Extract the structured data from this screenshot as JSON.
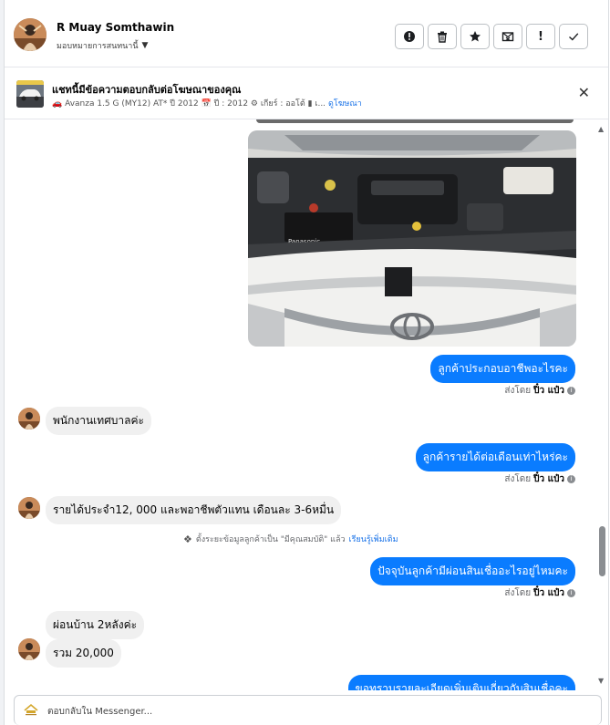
{
  "header": {
    "name": "R Muay Somthawin",
    "assign_label": "มอบหมายการสนทนานี้",
    "actions": [
      {
        "icon": "alert-circle-icon",
        "glyph": "❗"
      },
      {
        "icon": "trash-icon",
        "glyph": "🗑"
      },
      {
        "icon": "star-icon",
        "glyph": "★"
      },
      {
        "icon": "mail-x-icon",
        "glyph": "✉"
      },
      {
        "icon": "exclamation-icon",
        "glyph": "!"
      },
      {
        "icon": "check-icon",
        "glyph": "✓"
      }
    ]
  },
  "ad": {
    "title": "แชทนี้มีข้อความตอบกลับต่อโฆษณาของคุณ",
    "meta": "🚗 Avanza 1.5 G (MY12) AT* ปี 2012 📅 ปี : 2012 ⚙ เกียร์ : ออโต้ ▮ เ...",
    "link": "ดูโฆษณา"
  },
  "messages": {
    "out1": "ลูกค้าประกอบอาชีพอะไรคะ",
    "sent_prefix": "ส่งโดย",
    "sender": "ปิ๋ว แป๋ว",
    "in1": "พนักงานเทศบาลค่ะ",
    "out2": "ลูกค้ารายได้ต่อเดือนเท่าไหร่คะ",
    "in2": "รายได้ประจำ12, 000 และพอาชีพตัวแทน เดือนละ 3-6หมื่น",
    "system_text": "ตั้งระยะข้อมูลลูกค้าเป็น \"มีคุณสมบัติ\" แล้ว",
    "system_link": "เรียนรู้เพิ่มเติม",
    "out3": "ปัจจุบันลูกค้ามีผ่อนสินเชื่ออะไรอยู่ไหมคะ",
    "in3": "ผ่อนบ้าน 2หลังค่ะ",
    "in4": "รวม 20,000",
    "out4": "ขอทราบรายละเอียดเพิ่มเติมเกี่ยวกับสินเชื่อคะ"
  },
  "composer": {
    "placeholder": "ตอบกลับใน Messenger..."
  },
  "colors": {
    "outgoing_bubble": "#0a7cff",
    "incoming_bubble": "#f0f0f0",
    "link": "#1a73e8"
  }
}
